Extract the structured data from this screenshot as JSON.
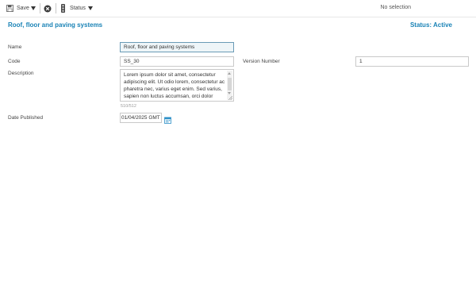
{
  "toolbar": {
    "save_label": "Save",
    "status_label": "Status",
    "no_selection": "No selection"
  },
  "record": {
    "title": "Roof, floor and paving systems",
    "status": "Status: Active"
  },
  "form": {
    "name_label": "Name",
    "name_value": "Roof, floor and paving systems",
    "code_label": "Code",
    "code_value": "SS_30",
    "version_label": "Version Number",
    "version_value": "1",
    "description_label": "Description",
    "description_value": "Lorem ipsum dolor sit amet, consectetur adipiscing elit. Ut odio lorem, consectetur ac pharetra nec, varius eget enim. Sed varius, sapien non luctus accumsan, orci dolor",
    "description_counter": "510/512",
    "date_label": "Date Published",
    "date_value": "01/04/2025 GMT"
  },
  "icons": {
    "save": "save-icon",
    "dropdown": "caret-down-icon",
    "cancel": "close-circle-icon",
    "status": "traffic-light-icon",
    "calendar": "calendar-icon"
  },
  "colors": {
    "accent": "#1a83b6",
    "calendar_icon": "#2b8fc7"
  }
}
